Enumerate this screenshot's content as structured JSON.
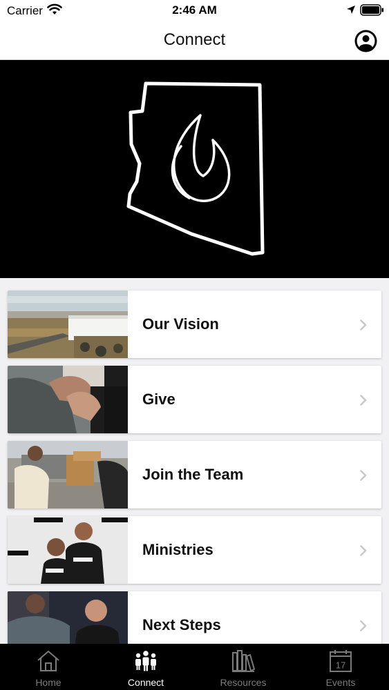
{
  "status_bar": {
    "carrier": "Carrier",
    "time": "2:46 AM",
    "icons": [
      "wifi-icon",
      "location-icon",
      "battery-icon"
    ]
  },
  "nav": {
    "title": "Connect",
    "profile_icon": "profile-icon"
  },
  "hero": {
    "logo": "arizona-flame-logo",
    "background": "#000000"
  },
  "menu": [
    {
      "label": "Our Vision",
      "thumb": "desert-building-photo"
    },
    {
      "label": "Give",
      "thumb": "praying-hands-photo"
    },
    {
      "label": "Join the Team",
      "thumb": "volunteers-photo"
    },
    {
      "label": "Ministries",
      "thumb": "couple-photo"
    },
    {
      "label": "Next Steps",
      "thumb": "baptism-photo"
    }
  ],
  "tabs": [
    {
      "label": "Home",
      "icon": "home-icon",
      "active": false
    },
    {
      "label": "Connect",
      "icon": "people-icon",
      "active": true
    },
    {
      "label": "Resources",
      "icon": "books-icon",
      "active": false
    },
    {
      "label": "Events",
      "icon": "calendar-icon",
      "active": false,
      "calendar_day": "17"
    }
  ],
  "colors": {
    "tab_bar_bg": "#000000",
    "tab_active": "#ffffff",
    "tab_inactive": "#7b7b7b",
    "list_bg": "#f1f1f3",
    "chevron": "#c7c7cc"
  }
}
